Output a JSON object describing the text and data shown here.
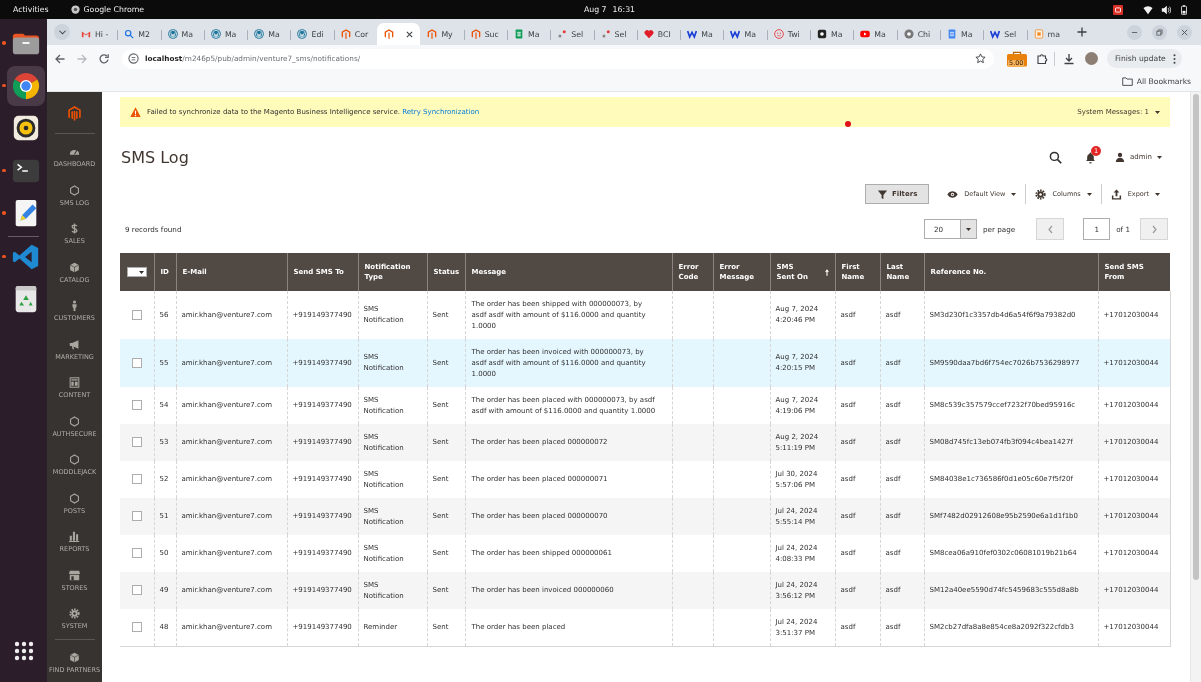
{
  "topbar": {
    "activities": "Activities",
    "app": "Google Chrome",
    "date": "Aug 7",
    "time": "16:31"
  },
  "dock": {
    "favorites": [
      {
        "kind": "files",
        "running": true,
        "selected": false
      },
      {
        "kind": "browser",
        "running": true,
        "selected": true
      },
      {
        "kind": "music",
        "running": false,
        "selected": false
      },
      {
        "kind": "terminal",
        "running": true,
        "selected": false
      },
      {
        "kind": "editor",
        "running": true,
        "selected": false
      }
    ],
    "others": [
      {
        "kind": "code",
        "running": true,
        "selected": false
      },
      {
        "kind": "trash",
        "running": false,
        "selected": false
      }
    ]
  },
  "browser": {
    "tabs": [
      {
        "kind": "mail",
        "label": "Hi -",
        "selected": false
      },
      {
        "kind": "search",
        "label": "M2",
        "selected": false
      },
      {
        "kind": "round",
        "label": "Ma",
        "selected": false
      },
      {
        "kind": "round",
        "label": "Ma",
        "selected": false
      },
      {
        "kind": "round",
        "label": "Ma",
        "selected": false
      },
      {
        "kind": "round",
        "label": "Edi",
        "selected": false
      },
      {
        "kind": "hexagon",
        "label": "Cor",
        "selected": false
      },
      {
        "kind": "hexagon",
        "selected": true
      },
      {
        "kind": "hexagon",
        "label": "My",
        "selected": false
      },
      {
        "kind": "hexagon",
        "label": "Suc",
        "selected": false
      },
      {
        "kind": "sheet",
        "label": "Ma",
        "selected": false
      },
      {
        "kind": "dots",
        "label": "Sel",
        "selected": false
      },
      {
        "kind": "dots",
        "label": "Sel",
        "selected": false
      },
      {
        "kind": "heart",
        "label": "BCI",
        "selected": false
      },
      {
        "kind": "zigzag",
        "label": "Ma",
        "selected": false
      },
      {
        "kind": "zigzag",
        "label": "Ma",
        "selected": false
      },
      {
        "kind": "smiley",
        "label": "Twi",
        "selected": false
      },
      {
        "kind": "square",
        "label": "Ma",
        "selected": false
      },
      {
        "kind": "play",
        "label": "Ma",
        "selected": false
      },
      {
        "kind": "ring",
        "label": "Chi",
        "selected": false
      },
      {
        "kind": "doc",
        "label": "Ma",
        "selected": false
      },
      {
        "kind": "zigzag",
        "label": "Sel",
        "selected": false
      },
      {
        "kind": "tile",
        "label": "ma",
        "selected": false
      }
    ],
    "url": "**localhost**/m246p5/pub/admin/venture7_sms/notifications/",
    "extension_badge": "5.00",
    "update_button": "Finish update",
    "bookmarks_button": "All Bookmarks"
  },
  "admin_menu": {
    "items": [
      {
        "kind": "dashboard",
        "label": "DASHBOARD"
      },
      {
        "kind": "hexagon",
        "label": "SMS LOG"
      },
      {
        "kind": "dollar",
        "label": "SALES"
      },
      {
        "kind": "cube",
        "label": "CATALOG"
      },
      {
        "kind": "person",
        "label": "CUSTOMERS"
      },
      {
        "kind": "megaphone",
        "label": "MARKETING"
      },
      {
        "kind": "layout",
        "label": "CONTENT"
      },
      {
        "kind": "hexagon",
        "label": "AUTHSECURE"
      },
      {
        "kind": "hexagon",
        "label": "MODDLEJACK"
      },
      {
        "kind": "hexagon",
        "label": "POSTS"
      },
      {
        "kind": "bars",
        "label": "REPORTS"
      },
      {
        "kind": "store",
        "label": "STORES"
      },
      {
        "kind": "gear",
        "label": "SYSTEM"
      }
    ],
    "more_items": [
      {
        "kind": "cube",
        "label": "FIND PARTNERS"
      }
    ]
  },
  "system_message": {
    "text": "Failed to synchronize data to the Magento Business Intelligence service.",
    "link": "Retry Synchronization",
    "count": "System Messages: 1"
  },
  "header": {
    "title": "SMS Log",
    "notifications": "1",
    "user": "admin"
  },
  "toolbar": {
    "filters": "Filters",
    "view": "Default View",
    "columns": "Columns",
    "export": "Export"
  },
  "pager": {
    "records": "9 records found",
    "per_page": "20",
    "per_page_label": "per page",
    "page": "1",
    "total": "of 1"
  },
  "table": {
    "columns": [
      {
        "label": "ID",
        "sorted": false
      },
      {
        "label": "E-Mail",
        "sorted": false
      },
      {
        "label": "Send SMS To",
        "sorted": false
      },
      {
        "label": "Notification Type",
        "sorted": false
      },
      {
        "label": "Status",
        "sorted": false
      },
      {
        "label": "Message",
        "sorted": false
      },
      {
        "label": "Error Code",
        "sorted": false
      },
      {
        "label": "Error Message",
        "sorted": false
      },
      {
        "label": "SMS Sent On",
        "sorted": true
      },
      {
        "label": "First Name",
        "sorted": false
      },
      {
        "label": "Last Name",
        "sorted": false
      },
      {
        "label": "Reference No.",
        "sorted": false
      },
      {
        "label": "Send SMS From",
        "sorted": false
      }
    ],
    "rows": [
      {
        "id": "56",
        "email": "amir.khan@venture7.com",
        "send_to": "+919149377490",
        "type": "SMS Notification",
        "status": "Sent",
        "message": "The order has been shipped with 000000073, by asdf asdf with amount of $116.0000 and quantity 1.0000",
        "sent_on": "Aug 7, 2024 4:20:46 PM",
        "first_name": "asdf",
        "last_name": "asdf",
        "reference": "SM3d230f1c3357db4d6a54f6f9a79382d0",
        "send_from": "+17012030044",
        "checked": false,
        "hovered": false
      },
      {
        "id": "55",
        "email": "amir.khan@venture7.com",
        "send_to": "+919149377490",
        "type": "SMS Notification",
        "status": "Sent",
        "message": "The order has been invoiced with 000000073, by asdf asdf with amount of $116.0000 and quantity 1.0000",
        "sent_on": "Aug 7, 2024 4:20:15 PM",
        "first_name": "asdf",
        "last_name": "asdf",
        "reference": "SM9590daa7bd6f754ec7026b7536298977",
        "send_from": "+17012030044",
        "checked": false,
        "hovered": true
      },
      {
        "id": "54",
        "email": "amir.khan@venture7.com",
        "send_to": "+919149377490",
        "type": "SMS Notification",
        "status": "Sent",
        "message": "The order has been placed with 000000073, by asdf asdf with amount of $116.0000 and quantity 1.0000",
        "sent_on": "Aug 7, 2024 4:19:06 PM",
        "first_name": "asdf",
        "last_name": "asdf",
        "reference": "SM8c539c357579ccef7232f70bed95916c",
        "send_from": "+17012030044",
        "checked": false,
        "hovered": false
      },
      {
        "id": "53",
        "email": "amir.khan@venture7.com",
        "send_to": "+919149377490",
        "type": "SMS Notification",
        "status": "Sent",
        "message": "The order has been placed 000000072",
        "sent_on": "Aug 2, 2024 5:11:19 PM",
        "first_name": "asdf",
        "last_name": "asdf",
        "reference": "SM08d745fc13eb074fb3f094c4bea1427f",
        "send_from": "+17012030044",
        "checked": false,
        "hovered": false
      },
      {
        "id": "52",
        "email": "amir.khan@venture7.com",
        "send_to": "+919149377490",
        "type": "SMS Notification",
        "status": "Sent",
        "message": "The order has been placed 000000071",
        "sent_on": "Jul 30, 2024 5:57:06 PM",
        "first_name": "asdf",
        "last_name": "asdf",
        "reference": "SM84038e1c736586f0d1e05c60e7f5f20f",
        "send_from": "+17012030044",
        "checked": false,
        "hovered": false
      },
      {
        "id": "51",
        "email": "amir.khan@venture7.com",
        "send_to": "+919149377490",
        "type": "SMS Notification",
        "status": "Sent",
        "message": "The order has been placed 000000070",
        "sent_on": "Jul 24, 2024 5:55:14 PM",
        "first_name": "asdf",
        "last_name": "asdf",
        "reference": "SMf7482d02912608e95b2590e6a1d1f1b0",
        "send_from": "+17012030044",
        "checked": false,
        "hovered": false
      },
      {
        "id": "50",
        "email": "amir.khan@venture7.com",
        "send_to": "+919149377490",
        "type": "SMS Notification",
        "status": "Sent",
        "message": "The order has been shipped 000000061",
        "sent_on": "Jul 24, 2024 4:08:33 PM",
        "first_name": "asdf",
        "last_name": "asdf",
        "reference": "SM8cea06a910fef0302c06081019b21b64",
        "send_from": "+17012030044",
        "checked": false,
        "hovered": false
      },
      {
        "id": "49",
        "email": "amir.khan@venture7.com",
        "send_to": "+919149377490",
        "type": "SMS Notification",
        "status": "Sent",
        "message": "The order has been invoiced 000000060",
        "sent_on": "Jul 24, 2024 3:56:12 PM",
        "first_name": "asdf",
        "last_name": "asdf",
        "reference": "SM12a40ee5590d74fc5459683c555d8a8b",
        "send_from": "+17012030044",
        "checked": false,
        "hovered": false
      },
      {
        "id": "48",
        "email": "amir.khan@venture7.com",
        "send_to": "+919149377490",
        "type": "Reminder",
        "status": "Sent",
        "message": "The order has been placed",
        "sent_on": "Jul 24, 2024 3:51:37 PM",
        "first_name": "asdf",
        "last_name": "asdf",
        "reference": "SM2cb27dfa8a8e854ce8a2092f322cfdb3",
        "send_from": "+17012030044",
        "checked": false,
        "hovered": false
      }
    ]
  }
}
